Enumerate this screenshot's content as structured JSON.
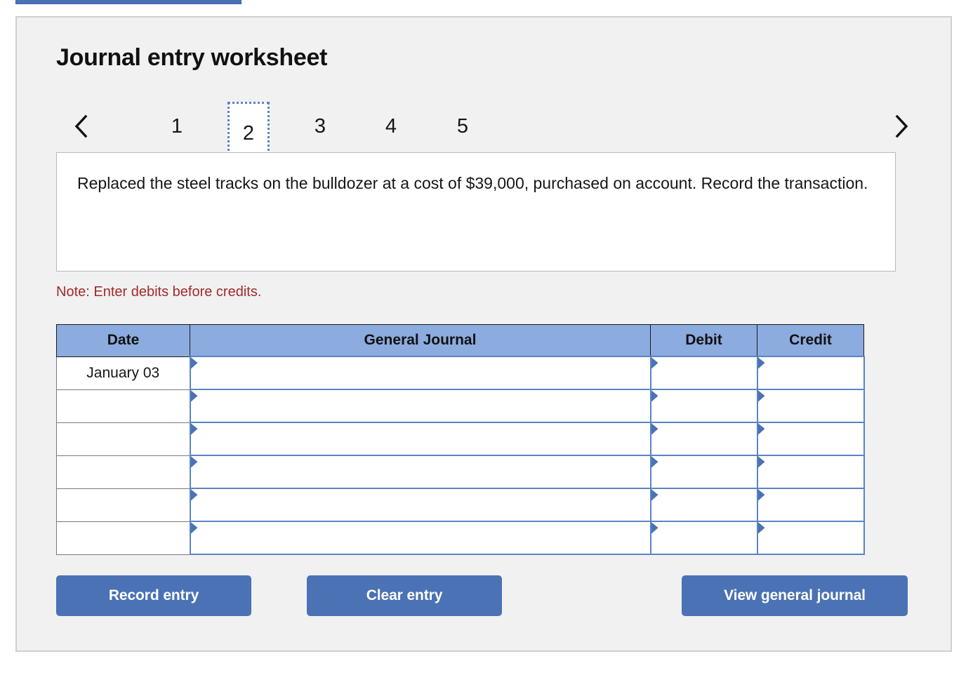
{
  "title": "Journal entry worksheet",
  "pager": {
    "prev_icon": "chevron-left-icon",
    "next_icon": "chevron-right-icon",
    "pages": [
      "1",
      "2",
      "3",
      "4",
      "5"
    ],
    "active_page": "2"
  },
  "description": "Replaced the steel tracks on the bulldozer at a cost of $39,000, purchased on account. Record the transaction.",
  "note": "Note: Enter debits before credits.",
  "table": {
    "headers": [
      "Date",
      "General Journal",
      "Debit",
      "Credit"
    ],
    "rows": [
      {
        "date": "January 03",
        "general_journal": "",
        "debit": "",
        "credit": ""
      },
      {
        "date": "",
        "general_journal": "",
        "debit": "",
        "credit": ""
      },
      {
        "date": "",
        "general_journal": "",
        "debit": "",
        "credit": ""
      },
      {
        "date": "",
        "general_journal": "",
        "debit": "",
        "credit": ""
      },
      {
        "date": "",
        "general_journal": "",
        "debit": "",
        "credit": ""
      },
      {
        "date": "",
        "general_journal": "",
        "debit": "",
        "credit": ""
      }
    ]
  },
  "buttons": {
    "record": "Record entry",
    "clear": "Clear entry",
    "view": "View general journal"
  },
  "colors": {
    "header_blue": "#8cabdf",
    "button_blue": "#4a72b5",
    "note_red": "#a32a2a",
    "panel_bg": "#f1f1f1",
    "input_border": "#5b84c4"
  }
}
